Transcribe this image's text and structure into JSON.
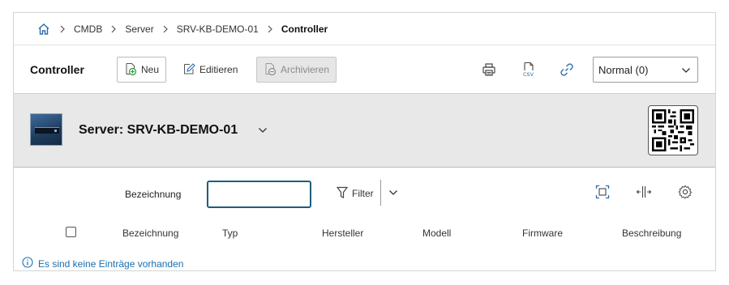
{
  "breadcrumb": {
    "home_icon": "home-icon",
    "items": [
      {
        "label": "CMDB"
      },
      {
        "label": "Server"
      },
      {
        "label": "SRV-KB-DEMO-01"
      },
      {
        "label": "Controller"
      }
    ]
  },
  "toolbar": {
    "title": "Controller",
    "new_label": "Neu",
    "edit_label": "Editieren",
    "archive_label": "Archivieren",
    "view_select": {
      "selected": "Normal (0)"
    },
    "icons": [
      "print-icon",
      "csv-icon",
      "link-icon"
    ]
  },
  "object": {
    "name": "Server: SRV-KB-DEMO-01"
  },
  "filter": {
    "label": "Bezeichnung",
    "value": "",
    "filter_label": "Filter"
  },
  "table": {
    "columns": [
      "Bezeichnung",
      "Typ",
      "Hersteller",
      "Modell",
      "Firmware",
      "Beschreibung"
    ],
    "empty_message": "Es sind keine Einträge vorhanden"
  },
  "colors": {
    "accent": "#1a6faf",
    "input_focus": "#1c5f7a",
    "header_bg": "#e8e8e8"
  }
}
